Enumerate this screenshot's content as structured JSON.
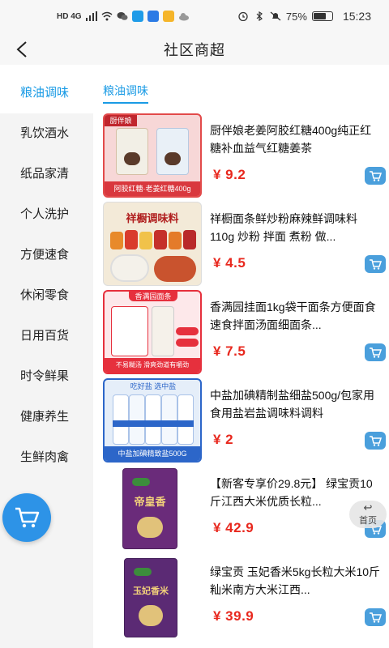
{
  "status_bar": {
    "left_text": "HD 4G",
    "battery": "75%",
    "battery_level": 0.75,
    "time": "15:23"
  },
  "header": {
    "title": "社区商超"
  },
  "sidebar": {
    "active_index": 0,
    "items": [
      {
        "label": "粮油调味"
      },
      {
        "label": "乳饮酒水"
      },
      {
        "label": "纸品家清"
      },
      {
        "label": "个人洗护"
      },
      {
        "label": "方便速食"
      },
      {
        "label": "休闲零食"
      },
      {
        "label": "日用百货"
      },
      {
        "label": "时令鲜果"
      },
      {
        "label": "健康养生"
      },
      {
        "label": "生鲜肉禽"
      }
    ]
  },
  "section": {
    "title": "粮油调味"
  },
  "products": [
    {
      "name": "厨伴娘老姜阿胶红糖400g纯正红糖补血益气红糖姜茶",
      "price": "¥ 9.2",
      "image_text": "阿胶红糖·老姜红糖400g",
      "brand_text": "厨伴娘"
    },
    {
      "name": "祥橱面条鲜炒粉麻辣鲜调味料110g 炒粉 拌面 煮粉 做...",
      "price": "¥ 4.5",
      "image_text": "祥橱调味料"
    },
    {
      "name": "香满园挂面1kg袋干面条方便面食速食拌面汤面细面条...",
      "price": "¥ 7.5",
      "image_text": "不易糊汤  滑爽劲道有嚼劲",
      "brand_text": "香满园面条"
    },
    {
      "name": "中盐加碘精制盐细盐500g/包家用食用盐岩盐调味料调料",
      "price": "¥ 2",
      "image_text": "中盐加碘精致盐500G",
      "brand_text": "吃好盐 选中盐"
    },
    {
      "name": "【新客专享价29.8元】 绿宝贡10斤江西大米优质长粒...",
      "price": "¥ 42.9",
      "image_text": "帝皇香"
    },
    {
      "name": "绿宝贡 玉妃香米5kg长粒大米10斤籼米南方大米江西...",
      "price": "¥ 39.9",
      "image_text": "玉妃香米"
    }
  ],
  "home_button": {
    "label": "首页"
  },
  "colors": {
    "accent": "#1a9be5",
    "price": "#e8281e",
    "cart_button": "#4a9fdc",
    "float_cart": "#2d93e7"
  },
  "icons": [
    "back-arrow-icon",
    "cart-icon",
    "home-return-icon"
  ]
}
